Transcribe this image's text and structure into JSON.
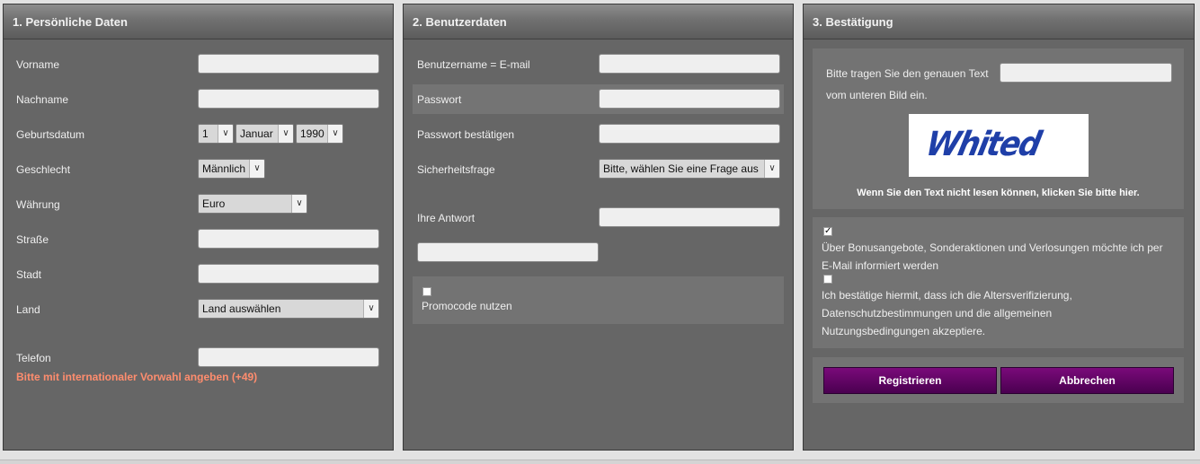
{
  "personal": {
    "title": "1. Persönliche Daten",
    "first_name_label": "Vorname",
    "last_name_label": "Nachname",
    "birthdate_label": "Geburtsdatum",
    "birth_day": "1",
    "birth_month": "Januar",
    "birth_year": "1990",
    "gender_label": "Geschlecht",
    "gender": "Männlich",
    "currency_label": "Währung",
    "currency": "Euro",
    "street_label": "Straße",
    "city_label": "Stadt",
    "country_label": "Land",
    "country": "Land auswählen",
    "phone_label": "Telefon",
    "phone_note": "Bitte mit internationaler Vorwahl angeben (+49)"
  },
  "user": {
    "title": "2. Benutzerdaten",
    "username_label": "Benutzername = E-mail",
    "password_label": "Passwort",
    "password_confirm_label": "Passwort bestätigen",
    "security_question_label": "Sicherheitsfrage",
    "security_question": "Bitte, wählen Sie eine Frage aus",
    "answer_label": "Ihre Antwort",
    "promo_label": "Promocode nutzen"
  },
  "confirm": {
    "title": "3. Bestätigung",
    "captcha_prompt_1": "Bitte tragen Sie den genauen Text",
    "captcha_prompt_2": "vom unteren Bild ein.",
    "captcha_text": "Whited",
    "captcha_refresh": "Wenn Sie den Text nicht lesen können, klicken Sie bitte hier.",
    "bonus_checked": true,
    "bonus_text_1": "Über Bonusangebote, Sonderaktionen und Verlosungen möchte ich per",
    "bonus_text_2": "E-Mail informiert werden",
    "terms_text_1": "Ich bestätige hiermit, dass ich die Altersverifizierung,",
    "terms_text_2": "Datenschutzbestimmungen und die allgemeinen",
    "terms_text_3": "Nutzungsbedingungen akzeptiere.",
    "register_label": "Registrieren",
    "cancel_label": "Abbrechen"
  },
  "colors": {
    "panel_bg": "#666666",
    "accent_button": "#5a0a5e",
    "note_color": "#ff8d6e"
  },
  "icons": {
    "dropdown": "chevron-down-icon",
    "checkbox_checked": "check-icon"
  }
}
